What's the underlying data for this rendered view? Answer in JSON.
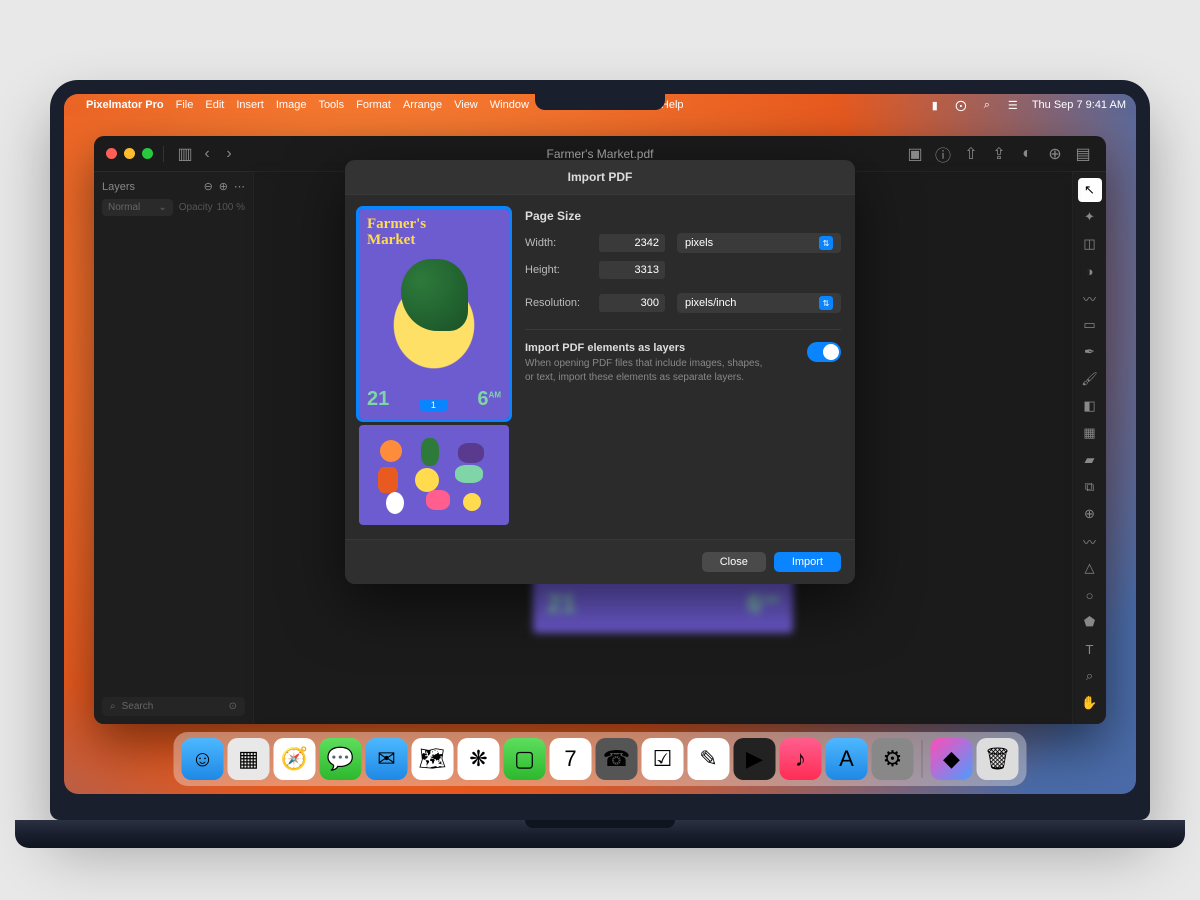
{
  "menubar": {
    "app": "Pixelmator Pro",
    "items": [
      "File",
      "Edit",
      "Insert",
      "Image",
      "Tools",
      "Format",
      "Arrange",
      "View",
      "Window",
      "Help"
    ],
    "datetime": "Thu Sep 7  9:41 AM"
  },
  "window": {
    "title": "Farmer's Market.pdf"
  },
  "sidebar": {
    "title": "Layers",
    "blend_mode": "Normal",
    "opacity_label": "Opacity",
    "opacity_value": "100 %",
    "search_placeholder": "Search"
  },
  "canvas": {
    "poster_title1": "Farmer's",
    "poster_title2": "Market",
    "date_left": "21",
    "date_right": "6",
    "ampm": "AM"
  },
  "dialog": {
    "title": "Import PDF",
    "section_page_size": "Page Size",
    "width_label": "Width:",
    "width_value": "2342",
    "height_label": "Height:",
    "height_value": "3313",
    "size_unit": "pixels",
    "resolution_label": "Resolution:",
    "resolution_value": "300",
    "resolution_unit": "pixels/inch",
    "layers_title": "Import PDF elements as layers",
    "layers_desc": "When opening PDF files that include images, shapes, or text, import these elements as separate layers.",
    "page_badge": "1",
    "close": "Close",
    "import": "Import"
  },
  "tools": [
    "arrow",
    "magic",
    "crop",
    "adjust",
    "draw",
    "rect",
    "pen",
    "brush",
    "erase",
    "gradient",
    "fill",
    "clone",
    "repair",
    "smudge",
    "sharpen",
    "blur",
    "shape",
    "text",
    "zoom",
    "hand"
  ],
  "dock": {
    "items": [
      {
        "name": "finder",
        "bg": "linear-gradient(#4db8ff,#1e88e5)",
        "glyph": "☺"
      },
      {
        "name": "launchpad",
        "bg": "#e8e8e8",
        "glyph": "▦"
      },
      {
        "name": "safari",
        "bg": "#fff",
        "glyph": "🧭"
      },
      {
        "name": "messages",
        "bg": "linear-gradient(#5dde5d,#2eb82e)",
        "glyph": "💬"
      },
      {
        "name": "mail",
        "bg": "linear-gradient(#4db8ff,#1e88e5)",
        "glyph": "✉"
      },
      {
        "name": "maps",
        "bg": "#fff",
        "glyph": "🗺"
      },
      {
        "name": "photos",
        "bg": "#fff",
        "glyph": "❋"
      },
      {
        "name": "facetime",
        "bg": "linear-gradient(#5dde5d,#2eb82e)",
        "glyph": "▢"
      },
      {
        "name": "calendar",
        "bg": "#fff",
        "glyph": "7"
      },
      {
        "name": "contacts",
        "bg": "#555",
        "glyph": "☎"
      },
      {
        "name": "reminders",
        "bg": "#fff",
        "glyph": "☑"
      },
      {
        "name": "notes",
        "bg": "#fff",
        "glyph": "✎"
      },
      {
        "name": "tv",
        "bg": "#222",
        "glyph": "▶"
      },
      {
        "name": "music",
        "bg": "linear-gradient(#ff5e8e,#ff2d55)",
        "glyph": "♪"
      },
      {
        "name": "appstore",
        "bg": "linear-gradient(#4db8ff,#1e88e5)",
        "glyph": "A"
      },
      {
        "name": "settings",
        "bg": "#888",
        "glyph": "⚙"
      }
    ],
    "right": [
      {
        "name": "pixelmator",
        "bg": "linear-gradient(135deg,#ff4db8,#4d9bff)",
        "glyph": "◆"
      },
      {
        "name": "trash",
        "bg": "#ddd",
        "glyph": "🗑"
      }
    ]
  }
}
